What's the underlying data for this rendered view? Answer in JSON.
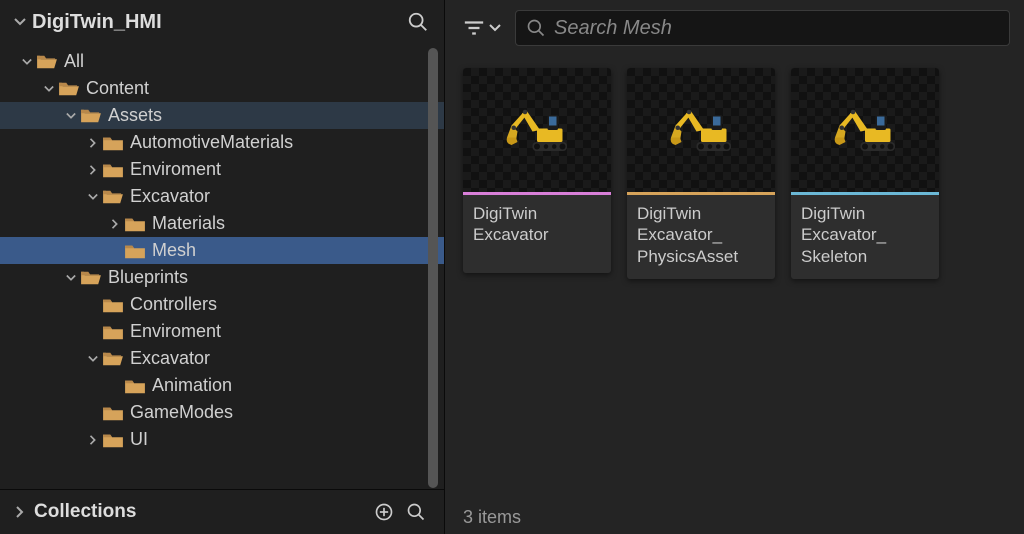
{
  "sidebar": {
    "title": "DigiTwin_HMI",
    "collections_label": "Collections"
  },
  "tree": [
    {
      "label": "All",
      "depth": 0,
      "expanded": true,
      "hasChildren": true,
      "selected": false
    },
    {
      "label": "Content",
      "depth": 1,
      "expanded": true,
      "hasChildren": true,
      "selected": false
    },
    {
      "label": "Assets",
      "depth": 2,
      "expanded": true,
      "hasChildren": true,
      "selected": false,
      "highlighted": true
    },
    {
      "label": "AutomotiveMaterials",
      "depth": 3,
      "expanded": false,
      "hasChildren": true,
      "selected": false
    },
    {
      "label": "Enviroment",
      "depth": 3,
      "expanded": false,
      "hasChildren": true,
      "selected": false
    },
    {
      "label": "Excavator",
      "depth": 3,
      "expanded": true,
      "hasChildren": true,
      "selected": false
    },
    {
      "label": "Materials",
      "depth": 4,
      "expanded": false,
      "hasChildren": true,
      "selected": false
    },
    {
      "label": "Mesh",
      "depth": 4,
      "expanded": false,
      "hasChildren": false,
      "selected": true
    },
    {
      "label": "Blueprints",
      "depth": 2,
      "expanded": true,
      "hasChildren": true,
      "selected": false
    },
    {
      "label": "Controllers",
      "depth": 3,
      "expanded": false,
      "hasChildren": false,
      "selected": false
    },
    {
      "label": "Enviroment",
      "depth": 3,
      "expanded": false,
      "hasChildren": false,
      "selected": false
    },
    {
      "label": "Excavator",
      "depth": 3,
      "expanded": true,
      "hasChildren": true,
      "selected": false
    },
    {
      "label": "Animation",
      "depth": 4,
      "expanded": false,
      "hasChildren": false,
      "selected": false
    },
    {
      "label": "GameModes",
      "depth": 3,
      "expanded": false,
      "hasChildren": false,
      "selected": false
    },
    {
      "label": "UI",
      "depth": 3,
      "expanded": false,
      "hasChildren": true,
      "selected": false
    }
  ],
  "search": {
    "placeholder": "Search Mesh"
  },
  "assets": [
    {
      "label": "DigiTwin\nExcavator",
      "stripe": "#d87fd8"
    },
    {
      "label": "DigiTwin\nExcavator_\nPhysicsAsset",
      "stripe": "#d6a35a"
    },
    {
      "label": "DigiTwin\nExcavator_\nSkeleton",
      "stripe": "#6bb8d6"
    }
  ],
  "status": {
    "item_count": "3 items"
  },
  "icons": {
    "folder_color": "#d6a35a",
    "folder_open_color": "#d6a35a"
  }
}
